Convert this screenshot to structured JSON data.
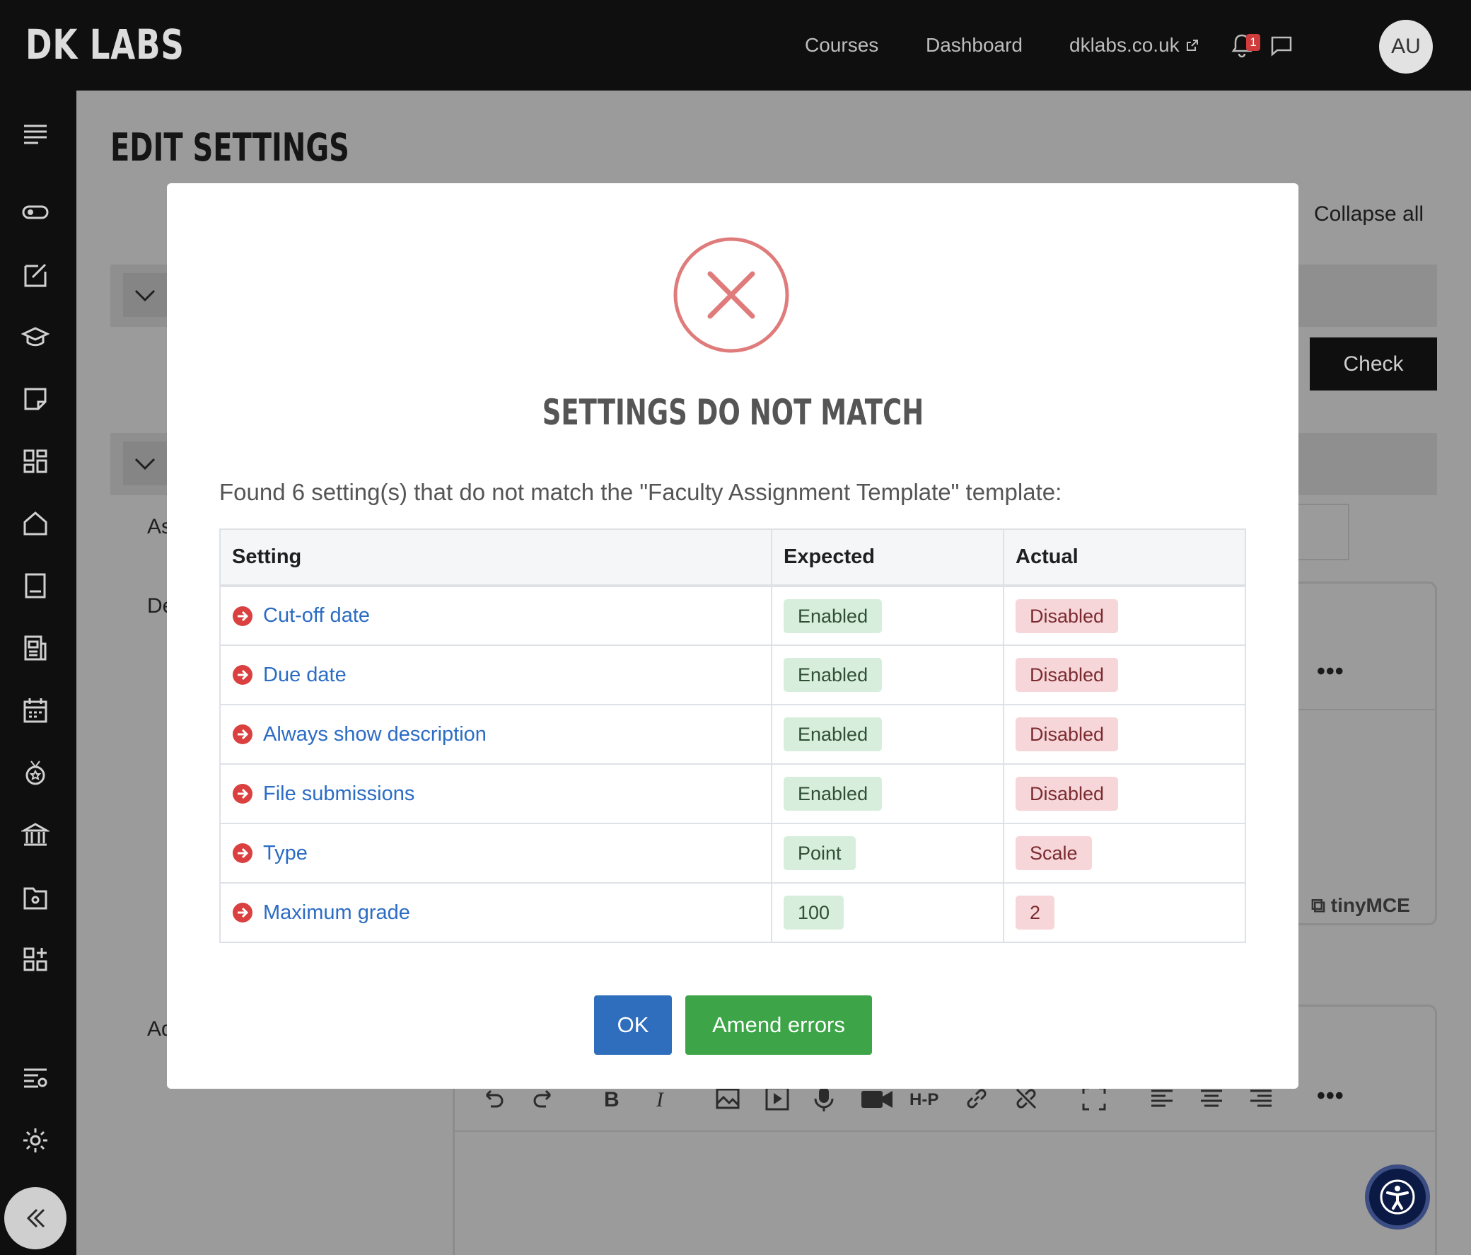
{
  "header": {
    "brand": "DK LABS",
    "nav": [
      {
        "label": "Courses"
      },
      {
        "label": "Dashboard"
      },
      {
        "label": "dklabs.co.uk"
      }
    ],
    "notification_count": "1",
    "avatar_initials": "AU"
  },
  "sidebar": {
    "items": [
      {
        "icon": "menu-icon"
      },
      {
        "icon": "toggle-icon"
      },
      {
        "icon": "edit-icon"
      },
      {
        "icon": "graduation-cap-icon"
      },
      {
        "icon": "note-icon"
      },
      {
        "icon": "dashboard-grid-icon"
      },
      {
        "icon": "home-icon"
      },
      {
        "icon": "book-icon"
      },
      {
        "icon": "news-icon"
      },
      {
        "icon": "calendar-icon"
      },
      {
        "icon": "badge-icon"
      },
      {
        "icon": "institution-icon"
      },
      {
        "icon": "folder-settings-icon"
      },
      {
        "icon": "add-block-icon"
      },
      {
        "icon": "admin-settings-icon"
      },
      {
        "icon": "gear-icon"
      }
    ]
  },
  "page": {
    "title": "EDIT SETTINGS",
    "collapse_all": "Collapse all",
    "check_button": "Check",
    "label_fragments": [
      "As",
      "De",
      "Ad"
    ],
    "editor_brand": "tinyMCE"
  },
  "modal": {
    "title": "SETTINGS DO NOT MATCH",
    "message": "Found 6 setting(s) that do not match the \"Faculty Assignment Template\" template:",
    "table": {
      "headers": [
        "Setting",
        "Expected",
        "Actual"
      ],
      "rows": [
        {
          "setting": "Cut-off date",
          "expected": "Enabled",
          "actual": "Disabled"
        },
        {
          "setting": "Due date",
          "expected": "Enabled",
          "actual": "Disabled"
        },
        {
          "setting": "Always show description",
          "expected": "Enabled",
          "actual": "Disabled"
        },
        {
          "setting": "File submissions",
          "expected": "Enabled",
          "actual": "Disabled"
        },
        {
          "setting": "Type",
          "expected": "Point",
          "actual": "Scale"
        },
        {
          "setting": "Maximum grade",
          "expected": "100",
          "actual": "2"
        }
      ]
    },
    "buttons": {
      "ok": "OK",
      "amend": "Amend errors"
    }
  },
  "colors": {
    "error": "#e07b7b",
    "link": "#2b6cc4",
    "ok_button": "#2f6ebd",
    "amend_button": "#3da548"
  }
}
